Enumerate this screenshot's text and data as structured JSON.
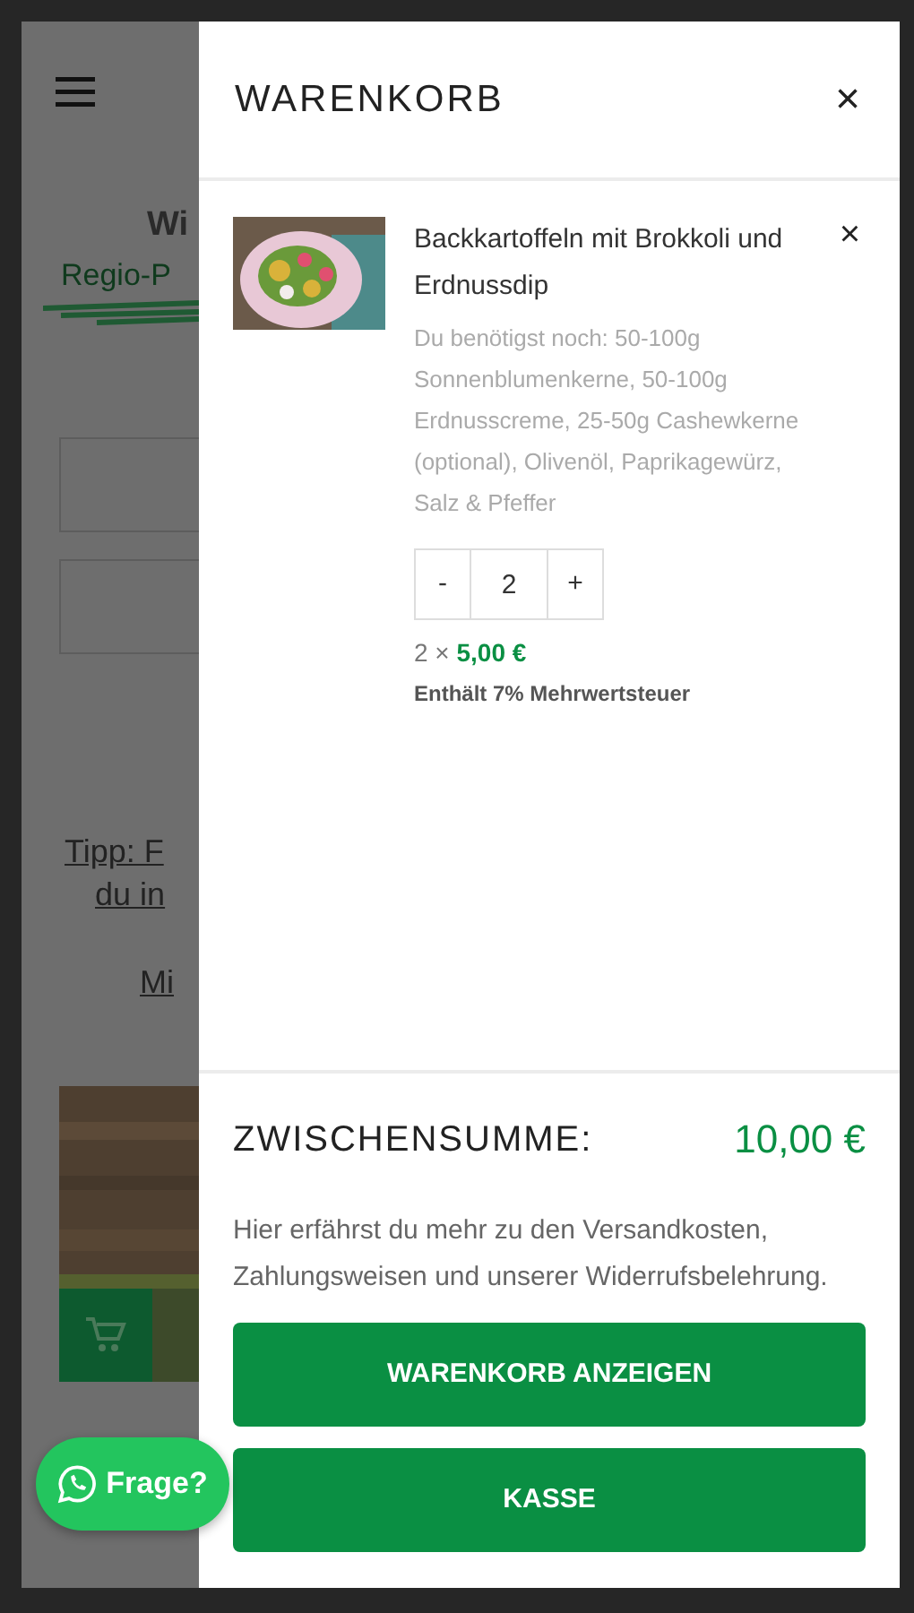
{
  "background_page": {
    "heading": "Wi",
    "subheading": "Regio-P",
    "tip_lines": [
      "Tipp: F",
      "du in"
    ],
    "link": "Mi"
  },
  "cart": {
    "title": "WARENKORB",
    "close": "×",
    "items": [
      {
        "name": "Backkartoffeln mit Brokkoli und Erdnussdip",
        "remove": "×",
        "description": "Du benötigst noch: 50-100g Sonnenblumenkerne, 50-100g Erdnusscreme, 25-50g Cashewkerne (optional), Olivenöl, Paprikagewürz, Salz & Pfeffer",
        "minus": "-",
        "quantity": "2",
        "plus": "+",
        "count": "2 ×",
        "price": "5,00 €",
        "tax": "Enthält 7% Mehrwertsteuer"
      }
    ],
    "subtotal_label": "ZWISCHENSUMME:",
    "subtotal": "10,00 €",
    "info": "Hier erfährst du mehr zu den Versandkosten, Zahlungsweisen und unserer Widerrufsbelehrung.",
    "buttons": [
      "WARENKORB ANZEIGEN",
      "KASSE"
    ]
  },
  "chat_button": {
    "label": "Frage?"
  }
}
